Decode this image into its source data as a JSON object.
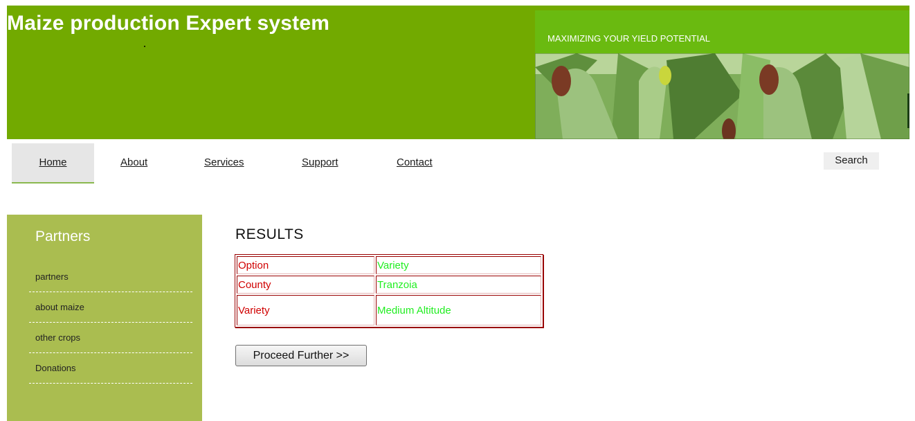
{
  "header": {
    "title": "Maize production Expert system",
    "tagline": "MAXIMIZING YOUR YIELD POTENTIAL",
    "background_color": "#72aa00",
    "banner_color": "#6aba10",
    "banner_image_icon": "maize-plants-photo-icon"
  },
  "nav": {
    "items": [
      {
        "label": "Home",
        "active": true
      },
      {
        "label": "About"
      },
      {
        "label": "Services"
      },
      {
        "label": "Support"
      },
      {
        "label": "Contact"
      }
    ],
    "search_label": "Search"
  },
  "sidebar": {
    "title": "Partners",
    "background_color": "#aabd50",
    "items": [
      {
        "label": "partners"
      },
      {
        "label": "about maize"
      },
      {
        "label": "other crops"
      },
      {
        "label": "Donations"
      }
    ]
  },
  "main": {
    "results_title": "RESULTS",
    "rows": [
      {
        "key": "Option",
        "value": "Variety"
      },
      {
        "key": "County",
        "value": "Tranzoia"
      },
      {
        "key": "Variety",
        "value": "Medium Altitude"
      }
    ],
    "key_color": "#d00000",
    "value_color": "#22ee22",
    "proceed_label": "Proceed Further >>"
  }
}
